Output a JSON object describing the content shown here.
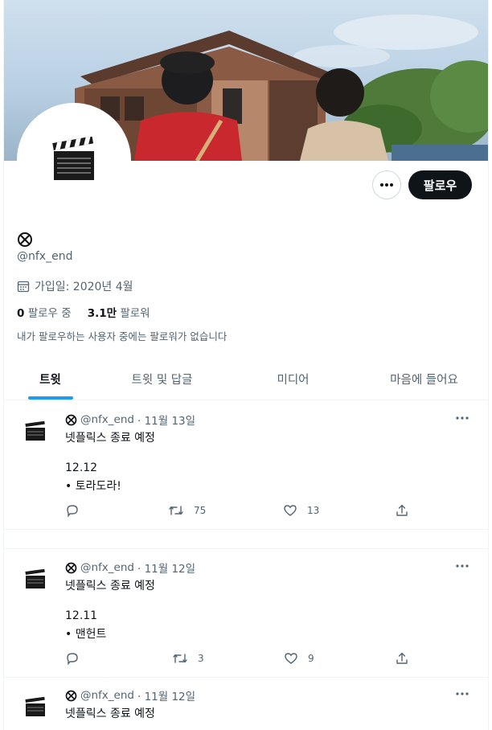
{
  "profile": {
    "handle": "@nfx_end",
    "joined": "가입일: 2020년 4월",
    "following_count": "0",
    "following_label": "팔로우 중",
    "followers_count": "3.1만",
    "followers_label": "팔로워",
    "no_mutual_text": "내가 팔로우하는 사용자 중에는 팔로워가 없습니다",
    "avatar_icon": "clapperboard-icon",
    "name_icon": "circle-x-icon"
  },
  "actions": {
    "follow_label": "팔로우",
    "more_icon": "more-icon"
  },
  "tabs": [
    {
      "label": "트윗",
      "active": true
    },
    {
      "label": "트윗 및 답글",
      "active": false
    },
    {
      "label": "미디어",
      "active": false
    },
    {
      "label": "마음에 들어요",
      "active": false
    }
  ],
  "tweets": [
    {
      "handle": "@nfx_end",
      "date": "· 11월 13일",
      "lines": [
        "넷플릭스 종료 예정",
        "12.12",
        "• 토라도라!"
      ],
      "retweets": "75",
      "likes": "13"
    },
    {
      "handle": "@nfx_end",
      "date": "· 11월 12일",
      "lines": [
        "넷플릭스 종료 예정",
        "12.11",
        "• 맨헌트"
      ],
      "retweets": "3",
      "likes": "9"
    },
    {
      "handle": "@nfx_end",
      "date": "· 11월 12일",
      "lines": [
        "넷플릭스 종료 예정"
      ],
      "retweets": "",
      "likes": ""
    }
  ],
  "colors": {
    "accent": "#1d9bf0",
    "text": "#0f1419",
    "muted": "#536471",
    "follow_bg": "#0f1419"
  }
}
